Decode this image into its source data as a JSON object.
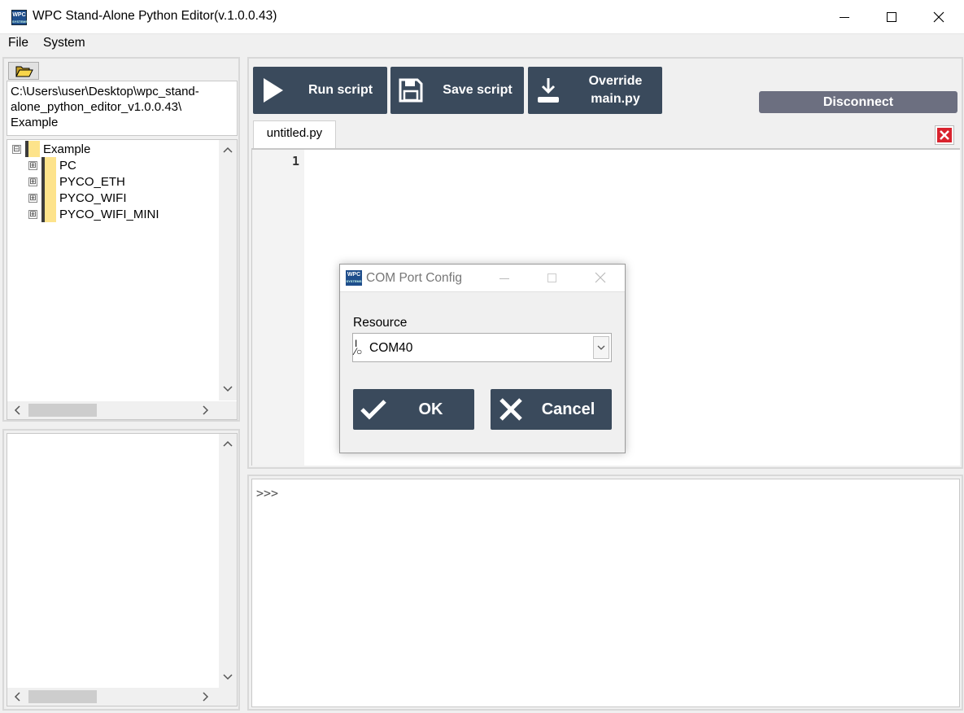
{
  "window": {
    "title": "WPC Stand-Alone Python Editor(v.1.0.0.43)",
    "logo_text": "WPC",
    "logo_sub": "SYSTEMS"
  },
  "menu": {
    "items": [
      "File",
      "System"
    ]
  },
  "file_browser": {
    "path": "C:\\Users\\user\\Desktop\\wpc_stand-\nalone_python_editor_v1.0.0.43\\\nExample",
    "tree": [
      {
        "label": "Example",
        "expander": "⊟"
      },
      {
        "label": "PC",
        "expander": "⊞"
      },
      {
        "label": "PYCO_ETH",
        "expander": "⊞"
      },
      {
        "label": "PYCO_WIFI",
        "expander": "⊞"
      },
      {
        "label": "PYCO_WIFI_MINI",
        "expander": "⊞"
      }
    ]
  },
  "toolbar": {
    "run_label": "Run script",
    "save_label": "Save script",
    "override_line1": "Override",
    "override_line2": "main.py",
    "disconnect_label": "Disconnect"
  },
  "editor": {
    "tab_label": "untitled.py",
    "line_numbers": [
      "1"
    ]
  },
  "console": {
    "prompt": ">>>"
  },
  "dialog": {
    "title": "COM Port Config",
    "logo_text": "WPC",
    "logo_sub": "SYSTEMS",
    "resource_label": "Resource",
    "combo_icon": "I/O",
    "selected_port": "COM40",
    "ok_label": "OK",
    "cancel_label": "Cancel"
  },
  "colors": {
    "button_bg": "#3a4a5c",
    "disconnect_bg": "#6c6f80",
    "close_tab_red": "#d9232e",
    "folder_yellow": "#fde38b"
  }
}
